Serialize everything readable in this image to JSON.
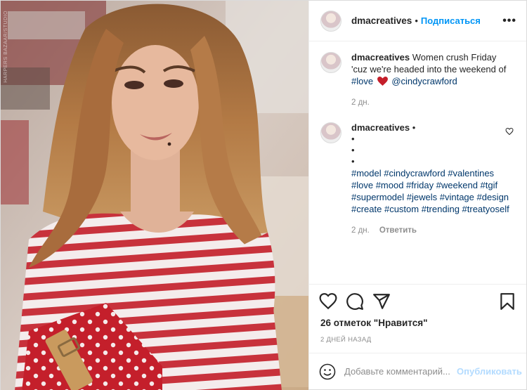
{
  "post": {
    "username": "dmacreatives",
    "follow_label": "Подписаться",
    "more_label": "•••",
    "watermark": "HARPERS BAZAAR/STUDIO"
  },
  "caption": {
    "username": "dmacreatives",
    "text": "Women crush Friday 'cuz we're headed into the weekend of",
    "hashtag": "#love",
    "mention": "@cindycrawford",
    "time": "2 дн."
  },
  "comment": {
    "username": "dmacreatives",
    "bullets": [
      "•",
      "•",
      "•"
    ],
    "hashtags": "#model #cindycrawford #valentines #love #mood #friday #weekend #tgif #supermodel #jewels #vintage #design #create #custom #trending #treatyoself",
    "time": "2 дн.",
    "reply_label": "Ответить"
  },
  "likes": "26 отметок \"Нравится\"",
  "date_posted": "2 ДНЕЙ НАЗАД",
  "add_comment": {
    "placeholder": "Добавьте комментарий...",
    "publish_label": "Опубликовать"
  },
  "icons": {
    "like": "heart-icon",
    "comment": "comment-icon",
    "share": "share-icon",
    "save": "bookmark-icon",
    "emoji": "emoji-icon",
    "red_heart": "red-heart-emoji"
  },
  "colors": {
    "link": "#0095f6",
    "hashtag": "#00376b",
    "muted": "#8e8e8e",
    "publish_disabled": "#b3dbff",
    "heart_red": "#c41e2a"
  }
}
